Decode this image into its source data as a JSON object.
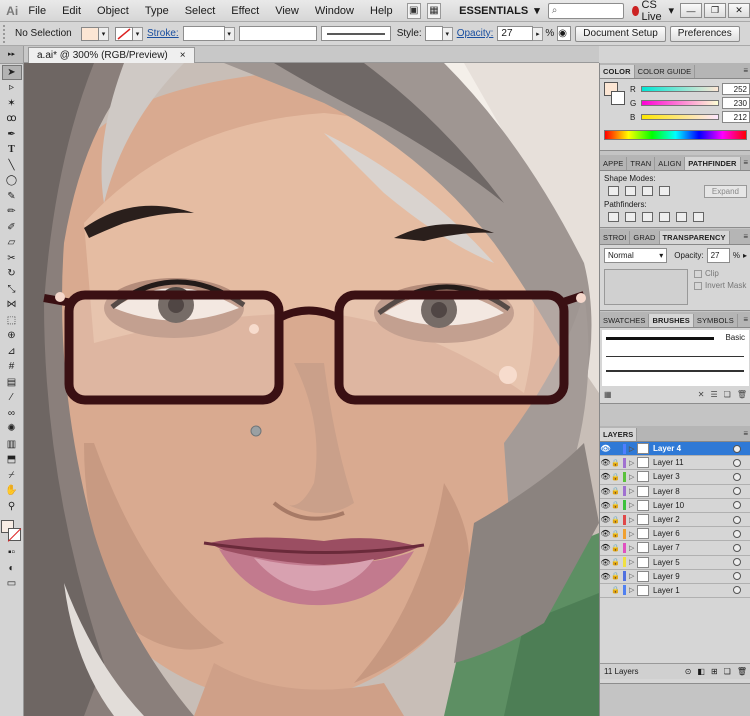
{
  "menubar": {
    "logo": "Ai",
    "items": [
      "File",
      "Edit",
      "Object",
      "Type",
      "Select",
      "Effect",
      "View",
      "Window",
      "Help"
    ],
    "workspace": "ESSENTIALS",
    "cs_live": "CS Live"
  },
  "controlbar": {
    "selection": "No Selection",
    "stroke_label": "Stroke:",
    "style_label": "Style:",
    "opacity_label": "Opacity:",
    "opacity_value": "27",
    "percent": "%",
    "document_setup": "Document Setup",
    "preferences": "Preferences"
  },
  "document": {
    "tab_title": "a.ai* @ 300% (RGB/Preview)",
    "close_glyph": "×"
  },
  "color_panel": {
    "tabs": [
      "COLOR",
      "COLOR GUIDE"
    ],
    "channels": [
      {
        "label": "R",
        "value": "252"
      },
      {
        "label": "G",
        "value": "230"
      },
      {
        "label": "B",
        "value": "212"
      }
    ],
    "fill_hex": "#fce6d4"
  },
  "pathfinder_panel": {
    "tabs": [
      "APPE",
      "TRAN",
      "ALIGN",
      "PATHFINDER"
    ],
    "shape_modes": "Shape Modes:",
    "expand": "Expand",
    "pathfinders": "Pathfinders:"
  },
  "transparency_panel": {
    "tabs": [
      "STROI",
      "GRAD",
      "TRANSPARENCY"
    ],
    "blend_mode": "Normal",
    "opacity_label": "Opacity:",
    "opacity_value": "27",
    "percent": "%",
    "clip": "Clip",
    "invert_mask": "Invert Mask"
  },
  "brushes_panel": {
    "tabs": [
      "SWATCHES",
      "BRUSHES",
      "SYMBOLS"
    ],
    "basic": "Basic"
  },
  "layers_panel": {
    "tab": "LAYERS",
    "layers": [
      {
        "name": "Layer 4",
        "color": "#4f7fff",
        "selected": true
      },
      {
        "name": "Layer 11",
        "color": "#a070d0",
        "selected": false
      },
      {
        "name": "Layer 3",
        "color": "#59c13b",
        "selected": false
      },
      {
        "name": "Layer 8",
        "color": "#a070d0",
        "selected": false
      },
      {
        "name": "Layer 10",
        "color": "#3bc13b",
        "selected": false
      },
      {
        "name": "Layer 2",
        "color": "#e04848",
        "selected": false
      },
      {
        "name": "Layer 6",
        "color": "#f0a030",
        "selected": false
      },
      {
        "name": "Layer 7",
        "color": "#e050c0",
        "selected": false
      },
      {
        "name": "Layer 5",
        "color": "#f0e040",
        "selected": false
      },
      {
        "name": "Layer 9",
        "color": "#5070e0",
        "selected": false
      },
      {
        "name": "Layer 1",
        "color": "#5080f0",
        "selected": false
      }
    ],
    "count_label": "11 Layers"
  }
}
